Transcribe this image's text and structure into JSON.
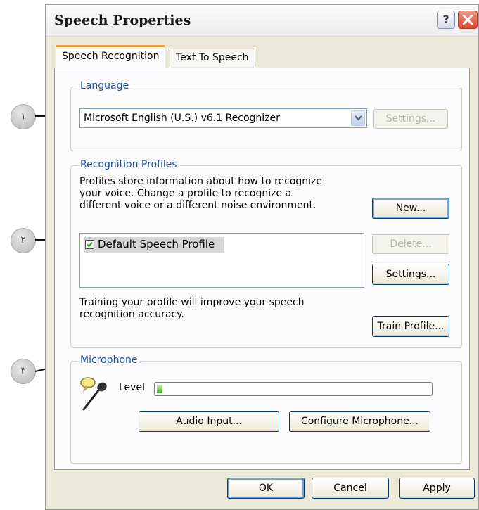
{
  "callouts": [
    {
      "label": "١"
    },
    {
      "label": "٢"
    },
    {
      "label": "٣"
    }
  ],
  "window": {
    "title": "Speech Properties",
    "help_label": "?",
    "tabs": [
      {
        "label": "Speech Recognition",
        "active": true
      },
      {
        "label": "Text To Speech",
        "active": false
      }
    ]
  },
  "language": {
    "legend": "Language",
    "selected": "Microsoft English (U.S.) v6.1 Recognizer",
    "settings_label": "Settings...",
    "settings_enabled": false
  },
  "profiles": {
    "legend": "Recognition Profiles",
    "description": "Profiles store information about how to recognize your voice.  Change a profile to recognize a different voice or a different noise environment.",
    "description_lines": [
      "Profiles store information about how to recognize",
      "your voice.  Change a profile to recognize a",
      "different voice or a different noise environment."
    ],
    "items": [
      {
        "label": "Default Speech Profile",
        "checked": true,
        "selected": true
      }
    ],
    "new_label": "New...",
    "delete_label": "Delete...",
    "settings_label": "Settings...",
    "training_lines": [
      "Training your profile will improve your speech",
      "recognition accuracy."
    ],
    "train_label": "Train Profile..."
  },
  "microphone": {
    "legend": "Microphone",
    "level_label": "Level",
    "level_fraction": 0.02,
    "audio_input_label": "Audio Input...",
    "configure_label": "Configure Microphone..."
  },
  "footer": {
    "ok_label": "OK",
    "cancel_label": "Cancel",
    "apply_label": "Apply"
  },
  "colors": {
    "legend_text": "#1a4fa8",
    "level_fill": "#3faa1f",
    "checkmark": "#2e9c2a",
    "close_button": "#d9482e"
  }
}
